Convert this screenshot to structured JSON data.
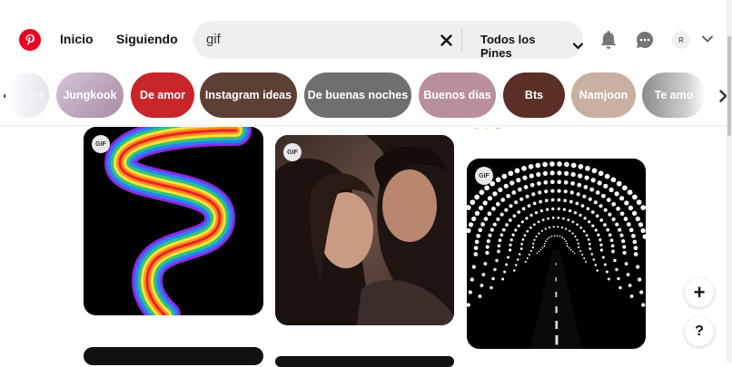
{
  "header": {
    "nav_home": "Inicio",
    "nav_following": "Siguiendo",
    "search_value": "gif",
    "search_scope": "Todos los Pines",
    "avatar_initial": "R",
    "brand_color": "#e60023"
  },
  "chips": [
    {
      "label": "Love"
    },
    {
      "label": "Jungkook"
    },
    {
      "label": "De amor"
    },
    {
      "label": "Instagram ideas"
    },
    {
      "label": "De buenas noches"
    },
    {
      "label": "Buenos días"
    },
    {
      "label": "Bts"
    },
    {
      "label": "Namjoon"
    },
    {
      "label": "Te amo"
    }
  ],
  "pins": [
    {
      "badge": "GIF",
      "subject": "rainbow ribbon"
    },
    {
      "badge": "GIF",
      "subject": "couple close-up"
    },
    {
      "badge": "GIF",
      "subject": "star tunnel road"
    }
  ],
  "floating": {
    "add_label": "+",
    "help_label": "?"
  }
}
